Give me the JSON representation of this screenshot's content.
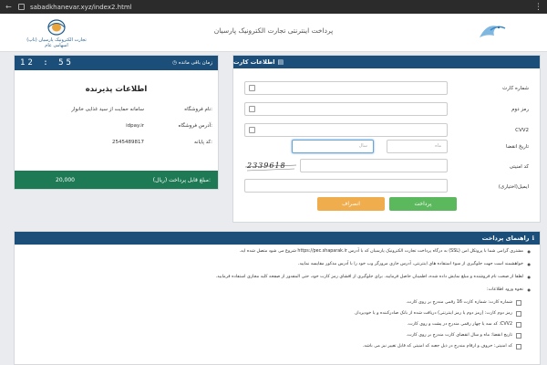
{
  "browser": {
    "url": "sabadkhanevar.xyz/index2.html"
  },
  "header": {
    "title": "پرداخت اینترنتی تجارت الکترونیک پارسیان",
    "logo_text_line1": "تجارت الکترونیک پارسیان (تاپ)",
    "logo_text_line2": "اسهامی عام"
  },
  "card_panel": {
    "heading": "اطلاعات کارت",
    "fields": {
      "card_number_label": "شماره کارت",
      "password_label": "رمز دوم",
      "cvv2_label": "CVV2",
      "expiry_label": "تاریخ انقضا",
      "expiry_month_placeholder": "ماه",
      "expiry_year_placeholder": "سال",
      "captcha_label": "کد امنیتی",
      "email_label": "ایمیل(اختیاری)"
    },
    "captcha_text": "2339618",
    "pay_label": "پرداخت",
    "cancel_label": "انصراف"
  },
  "merchant_panel": {
    "timer": "12 : 55",
    "timer_label": "زمان باقی مانده",
    "title": "اطلاعات پذیرنده",
    "store_name_label": "نام فروشگاه:",
    "store_name_value": "سامانه حمایت از سید غذایی خانوار",
    "store_address_label": "آدرس فروشگاه:",
    "store_address_value": "idpay.ir",
    "terminal_label": "کد پایانه:",
    "terminal_value": "2545489817",
    "amount_label": "مبلغ قابل پرداخت (ریال):",
    "amount_value": "20,000"
  },
  "guide_panel": {
    "heading": "راهنمای پرداخت",
    "items": [
      "مشتری گرامی شما با پروتکل امن (SSL) به درگاه پرداخت تجارت الکترونیک پارسیان که با آدرس https://pec.shaparak.ir شروع می شود متصل شده اید.",
      "خواهشمند است جهت جلوگیری از سوء استفاده های اینترنتی، آدرس جاری مرورگر وب خود را با آدرس مذکور مقایسه نمایید.",
      "لطفا از صحت نام فروشنده و مبلغ نمایش داده شده، اطمینان حاصل فرمایید. برای جلوگیری از افشای رمز کارت خود، حتی المقدور از صفحه کلید مجازی استفاده فرمایید.",
      "نحوه ورود اطلاعات:"
    ],
    "sub_items": [
      "شماره کارت: شماره کارت 16 رقمی مندرج بر روی کارت.",
      "رمز دوم کارت: (رمز دوم یا رمز اینترنتی) دریافت شده از بانک صادرکننده و یا خودپرداز.",
      "CVV2: کد سه یا چهار رقمی مندرج در پشت و روی کارت.",
      "تاریخ انقضا: ماه و سال انقضای کارت مندرج بر روی کارت.",
      "کد امنیتی: حروف و ارقام مندرج در ذیل جعبه کد امنیتی که قابل تغییر نیز می باشد."
    ]
  },
  "colors": {
    "header_blue": "#1b4f7a",
    "pay_green": "#5cb85c",
    "cancel_orange": "#f0ad4e",
    "amount_green": "#1e7a55"
  }
}
